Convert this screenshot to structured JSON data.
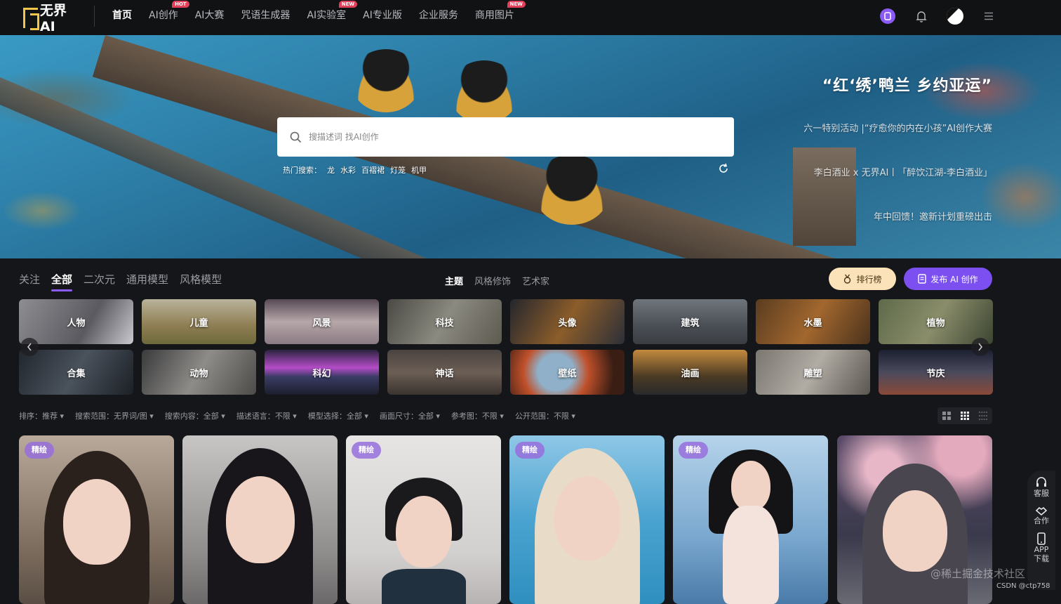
{
  "nav": {
    "logo": "无界AI",
    "items": [
      {
        "label": "首页",
        "badge": ""
      },
      {
        "label": "AI创作",
        "badge": "HOT"
      },
      {
        "label": "AI大赛",
        "badge": ""
      },
      {
        "label": "咒语生成器",
        "badge": ""
      },
      {
        "label": "AI实验室",
        "badge": "NEW"
      },
      {
        "label": "AI专业版",
        "badge": ""
      },
      {
        "label": "企业服务",
        "badge": ""
      },
      {
        "label": "商用图片",
        "badge": "NEW"
      }
    ]
  },
  "hero": {
    "title": "“红‘绣’鸭兰 乡约亚运”",
    "links": [
      "六一特别活动 |“疗愈你的内在小孩”AI创作大赛",
      "李白酒业 x 无界AI丨「醉饮江湖-李白酒业」",
      "年中回馈！邀新计划重磅出击"
    ],
    "search_placeholder": "搜描述词 找AI创作",
    "hot_label": "热门搜索：",
    "hot_terms": [
      "龙",
      "水彩",
      "百褶裙",
      "灯笼",
      "机甲"
    ]
  },
  "filter": {
    "tabs_left": [
      "关注",
      "全部",
      "二次元",
      "通用模型",
      "风格模型"
    ],
    "tabs_mid": [
      "主题",
      "风格修饰",
      "艺术家"
    ],
    "rank_label": "排行榜",
    "publish_label": "发布 AI 创作"
  },
  "categories": [
    "人物",
    "儿童",
    "风景",
    "科技",
    "头像",
    "建筑",
    "水墨",
    "植物",
    "合集",
    "动物",
    "科幻",
    "神话",
    "壁纸",
    "油画",
    "雕塑",
    "节庆"
  ],
  "sort": [
    {
      "label": "排序：",
      "value": "推荐"
    },
    {
      "label": "搜索范围：",
      "value": "无界词/图"
    },
    {
      "label": "搜索内容：",
      "value": "全部"
    },
    {
      "label": "描述语言：",
      "value": "不限"
    },
    {
      "label": "模型选择：",
      "value": "全部"
    },
    {
      "label": "画面尺寸：",
      "value": "全部"
    },
    {
      "label": "参考图：",
      "value": "不限"
    },
    {
      "label": "公开范围：",
      "value": "不限"
    }
  ],
  "gallery": {
    "badge": "精绘"
  },
  "side": {
    "service": "客服",
    "cooperate": "合作",
    "app": "APP下载"
  },
  "watermark": {
    "juejin": "@稀土掘金技术社区",
    "csdn": "CSDN @ctp758"
  }
}
